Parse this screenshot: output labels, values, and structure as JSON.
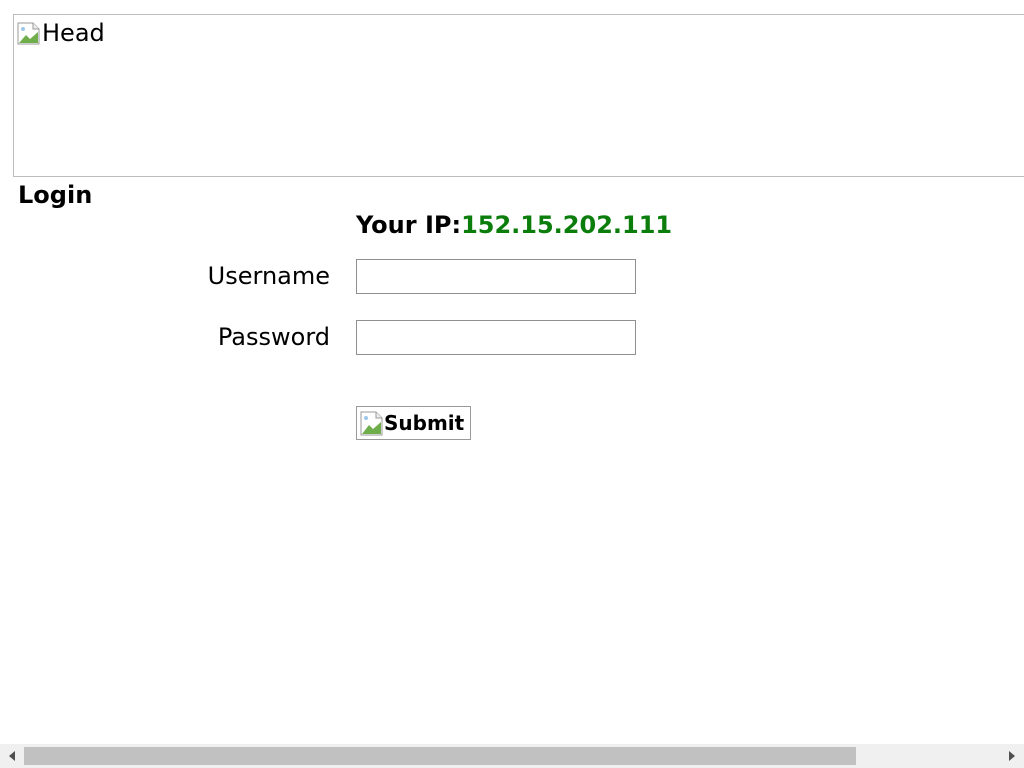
{
  "header": {
    "image_alt": "Head"
  },
  "login": {
    "title": "Login",
    "ip_label": "Your IP:",
    "ip_value": "152.15.202.111",
    "username_label": "Username",
    "username_value": "",
    "password_label": "Password",
    "password_value": "",
    "submit_alt": "Submit"
  },
  "colors": {
    "ip_value": "#0a7d0a",
    "border": "#8f8f8f",
    "scroll_thumb": "#c1c1c1",
    "scroll_track": "#f0f0f0"
  },
  "icons": {
    "broken_image": "broken-image-icon",
    "scroll_left": "triangle-left-icon",
    "scroll_right": "triangle-right-icon"
  },
  "scrollbar": {
    "horizontal_thumb_fraction": 0.81
  }
}
